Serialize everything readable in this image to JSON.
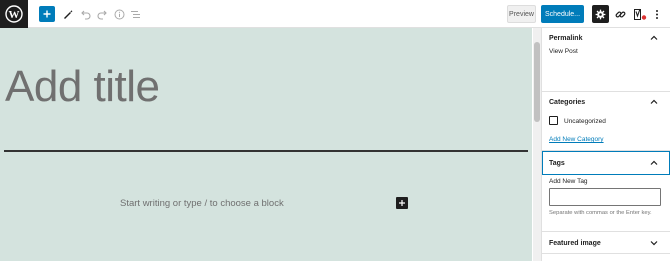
{
  "toolbar": {
    "logo_icon": "wordpress-icon",
    "add_icon": "plus-icon",
    "tools_icon": "pencil-icon",
    "undo_icon": "undo-icon",
    "redo_icon": "redo-icon",
    "details_icon": "info-icon",
    "outline_icon": "list-view-icon",
    "preview_label": "Preview",
    "schedule_label": "Schedule...",
    "settings_icon": "gear-icon",
    "link_icon": "link-icon",
    "yoast_icon": "yoast-icon",
    "more_icon": "more-vertical-icon",
    "accent": "#007cba"
  },
  "editor": {
    "title_placeholder": "Add title",
    "block_placeholder": "Start writing or type / to choose a block",
    "background": "#d4e3de"
  },
  "sidebar": {
    "permalink": {
      "title": "Permalink",
      "view_post": "View Post"
    },
    "categories": {
      "title": "Categories",
      "item": "Uncategorized",
      "checked": false,
      "add_new": "Add New Category"
    },
    "tags": {
      "title": "Tags",
      "field_label": "Add New Tag",
      "value": "",
      "help": "Separate with commas or the Enter key."
    },
    "featured_image": {
      "title": "Featured image"
    }
  }
}
